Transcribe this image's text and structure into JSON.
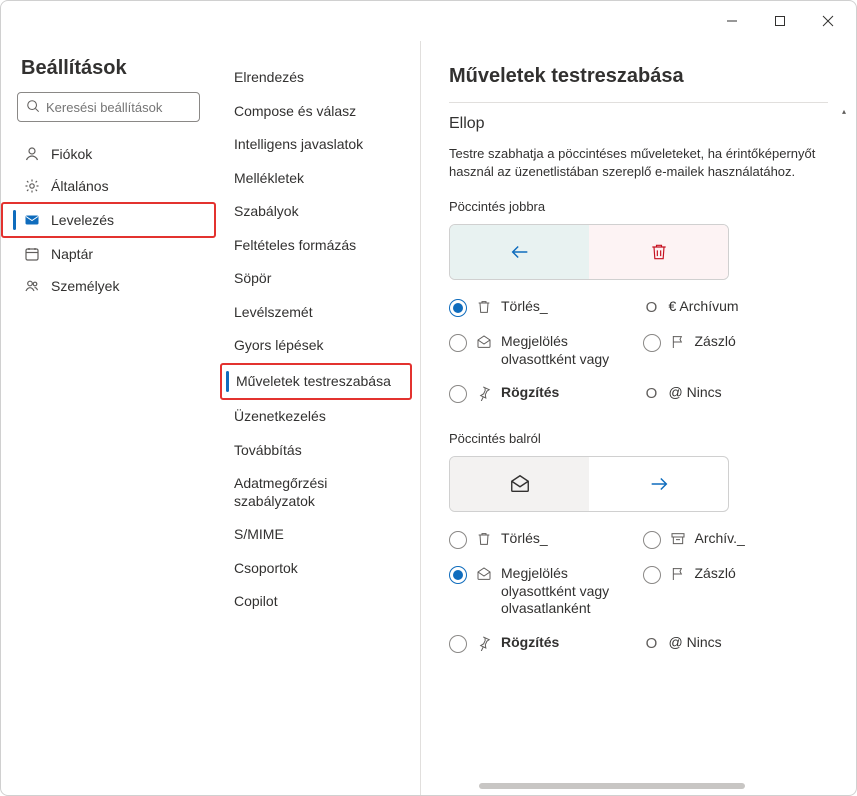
{
  "titlebar": {},
  "sidebar": {
    "title": "Beállítások",
    "search_placeholder": "Keresési beállítások",
    "items": [
      {
        "label": "Fiókok"
      },
      {
        "label": "Általános"
      },
      {
        "label": "Levelezés"
      },
      {
        "label": "Naptár"
      },
      {
        "label": "Személyek"
      }
    ]
  },
  "subnav": {
    "items": [
      {
        "label": "Elrendezés"
      },
      {
        "label": "Compose és válasz"
      },
      {
        "label": "Intelligens javaslatok"
      },
      {
        "label": "Mellékletek"
      },
      {
        "label": "Szabályok"
      },
      {
        "label": "Feltételes formázás"
      },
      {
        "label": "Söpör"
      },
      {
        "label": "Levélszemét"
      },
      {
        "label": "Gyors lépések"
      },
      {
        "label": "Műveletek testreszabása"
      },
      {
        "label": "Üzenetkezelés"
      },
      {
        "label": "Továbbítás"
      },
      {
        "label": "Adatmegőrzési szabályzatok"
      },
      {
        "label": "S/MIME"
      },
      {
        "label": "Csoportok"
      },
      {
        "label": "Copilot"
      }
    ]
  },
  "main": {
    "title": "Műveletek testreszabása",
    "section": "Ellop",
    "description": "Testre szabhatja a pöccintéses műveleteket, ha érintőképernyőt használ az üzenetlistában szereplő e-mailek használatához.",
    "swipe_right": {
      "label": "Pöccintés jobbra",
      "options": [
        {
          "label": "Törlés_",
          "icon": "delete",
          "checked": true
        },
        {
          "label": "€ Archívum",
          "icon": "",
          "checked": false
        },
        {
          "label": "Megjelölés olvasottként vagy",
          "icon": "mail-read",
          "checked": false
        },
        {
          "label": "Zászló",
          "icon": "flag",
          "checked": false
        },
        {
          "label": "Rögzítés",
          "icon": "pin",
          "checked": false
        },
        {
          "label": "@ Nincs",
          "icon": "",
          "checked": false
        }
      ]
    },
    "swipe_left": {
      "label": "Pöccintés balról",
      "options": [
        {
          "label": "Törlés_",
          "icon": "delete",
          "checked": false
        },
        {
          "label": "Archív._",
          "icon": "archive",
          "checked": false
        },
        {
          "label": "Megjelölés olyasottként vagy olvasatlanként",
          "icon": "mail-read",
          "checked": true
        },
        {
          "label": "Zászló",
          "icon": "flag",
          "checked": false
        },
        {
          "label": "Rögzítés",
          "icon": "pin",
          "checked": false
        },
        {
          "label": "@ Nincs",
          "icon": "",
          "checked": false
        }
      ]
    }
  }
}
